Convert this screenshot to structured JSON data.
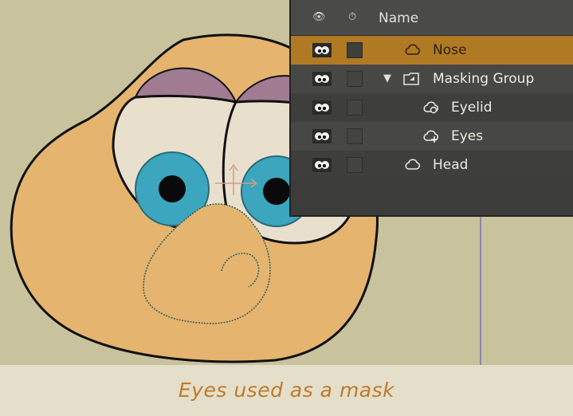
{
  "layers_panel": {
    "header": {
      "visibility_icon": "eye-column-icon",
      "lock_icon": "lock-column-icon",
      "name_label": "Name"
    },
    "layers": [
      {
        "name": "Nose",
        "icon": "shape-icon",
        "selected": true,
        "indent": 1
      },
      {
        "name": "Masking Group",
        "icon": "group-icon",
        "expanded": true,
        "indent": 0
      },
      {
        "name": "Eyelid",
        "icon": "shape-mask-icon",
        "indent": 2
      },
      {
        "name": "Eyes",
        "icon": "shape-mask-add-icon",
        "indent": 2
      },
      {
        "name": "Head",
        "icon": "shape-icon",
        "indent": 1
      }
    ]
  },
  "colors": {
    "canvas_bg": "#c9c39d",
    "panel_bg": "#3c3c3a",
    "selected_row": "#b07a24",
    "caption_text": "#c07a2a",
    "head_fill": "#e5b46f",
    "iris": "#3ba6bd",
    "eyelid": "#a07b92"
  },
  "caption": {
    "text": "Eyes used as a mask"
  }
}
